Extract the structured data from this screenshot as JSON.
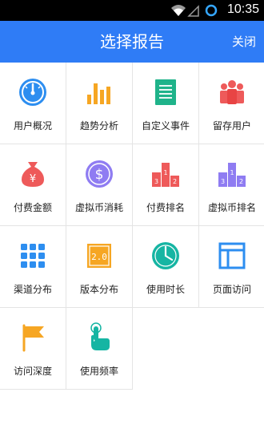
{
  "status_bar": {
    "time": "10:35"
  },
  "header": {
    "title": "选择报告",
    "close_label": "关闭"
  },
  "colors": {
    "header_bg": "#2f7cf6",
    "blue": "#2d8ef0",
    "orange": "#f6a623",
    "green": "#1fb38a",
    "red": "#ee5a5a",
    "purple": "#8f7cf2",
    "teal": "#16b5a3"
  },
  "grid": {
    "items": [
      {
        "label": "用户概况",
        "icon": "speedometer-icon"
      },
      {
        "label": "趋势分析",
        "icon": "bar-chart-icon"
      },
      {
        "label": "自定义事件",
        "icon": "document-icon"
      },
      {
        "label": "留存用户",
        "icon": "users-icon"
      },
      {
        "label": "付费金额",
        "icon": "money-bag-icon"
      },
      {
        "label": "虚拟币消耗",
        "icon": "dollar-coin-icon"
      },
      {
        "label": "付费排名",
        "icon": "podium-icon"
      },
      {
        "label": "虚拟币排名",
        "icon": "podium-icon"
      },
      {
        "label": "渠道分布",
        "icon": "grid-dots-icon"
      },
      {
        "label": "版本分布",
        "icon": "version-icon",
        "icon_text": "2.0"
      },
      {
        "label": "使用时长",
        "icon": "clock-icon"
      },
      {
        "label": "页面访问",
        "icon": "page-layout-icon"
      },
      {
        "label": "访问深度",
        "icon": "flag-icon"
      },
      {
        "label": "使用频率",
        "icon": "tap-hand-icon"
      }
    ]
  }
}
